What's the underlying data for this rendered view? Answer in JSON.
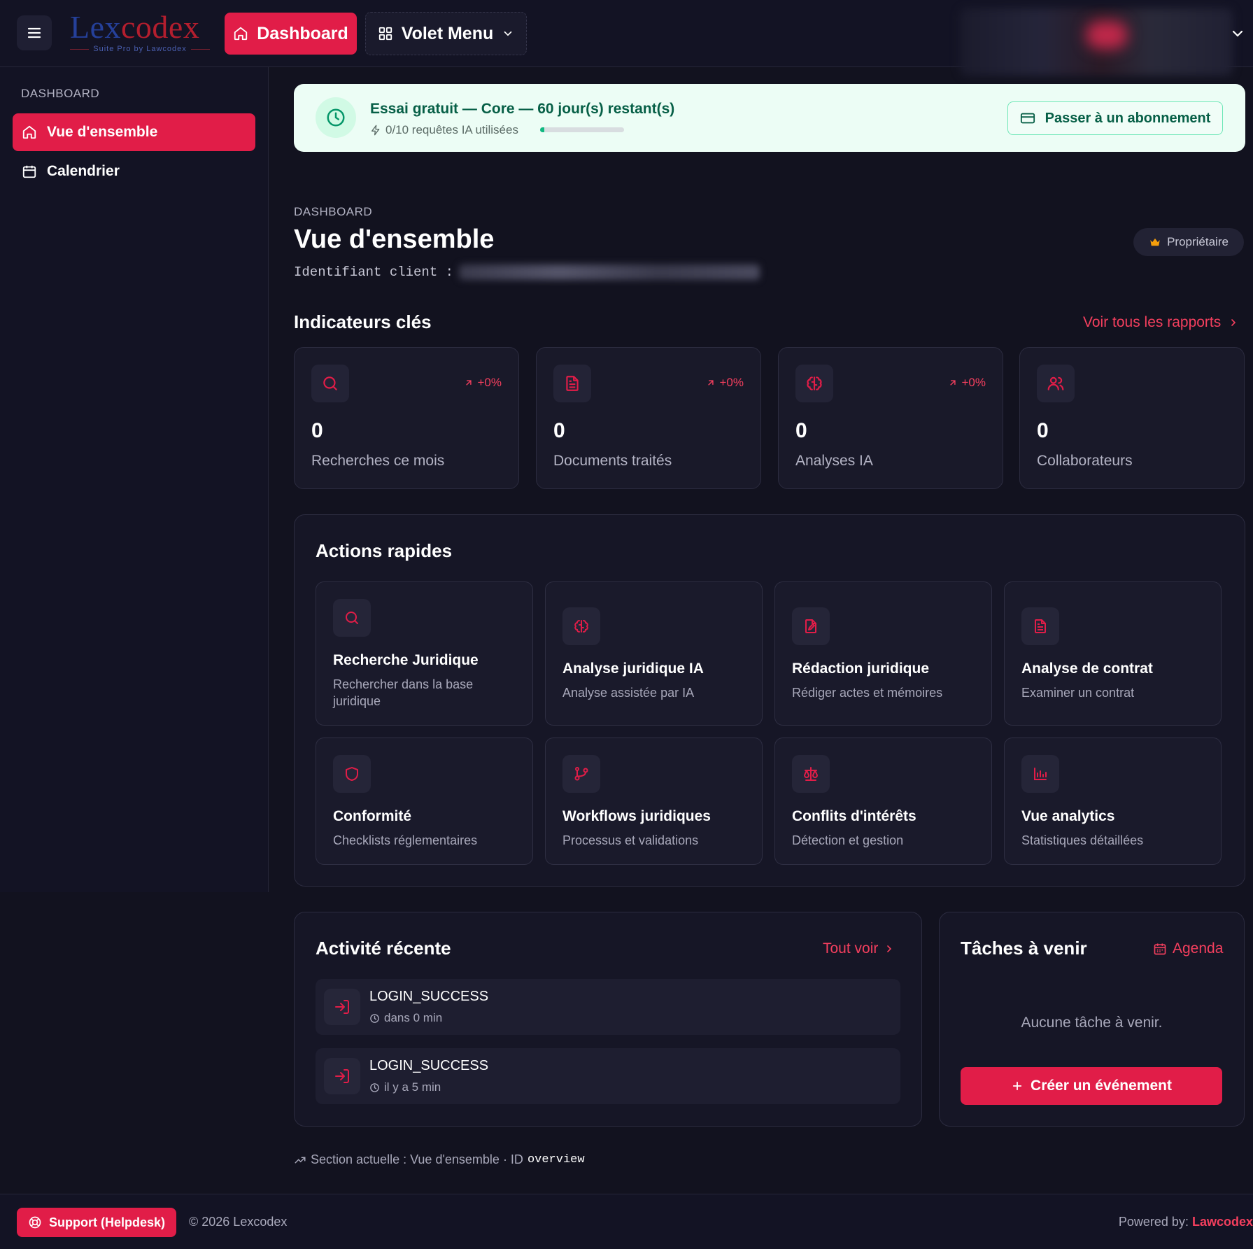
{
  "header": {
    "logo_text_a": "Lex",
    "logo_text_b": "codex",
    "logo_subtitle": "Suite Pro by Lawcodex",
    "dashboard_label": "Dashboard",
    "volet_label": "Volet Menu"
  },
  "sidebar": {
    "heading": "DASHBOARD",
    "items": [
      {
        "label": "Vue d'ensemble",
        "icon": "home-icon",
        "active": true
      },
      {
        "label": "Calendrier",
        "icon": "calendar-icon",
        "active": false
      }
    ]
  },
  "trial": {
    "title": "Essai gratuit — Core — 60 jour(s) restant(s)",
    "usage": "0/10 requêtes IA utilisées",
    "usage_fraction": 0.05,
    "upgrade_label": "Passer à un abonnement"
  },
  "page": {
    "breadcrumb": "DASHBOARD",
    "title": "Vue d'ensemble",
    "client_id_label": "Identifiant client :",
    "owner_badge": "Propriétaire"
  },
  "kpis": {
    "title": "Indicateurs clés",
    "see_all": "Voir tous les rapports",
    "items": [
      {
        "value": "0",
        "label": "Recherches ce mois",
        "trend": "+0%",
        "icon": "search-icon"
      },
      {
        "value": "0",
        "label": "Documents traités",
        "trend": "+0%",
        "icon": "document-icon"
      },
      {
        "value": "0",
        "label": "Analyses IA",
        "trend": "+0%",
        "icon": "brain-icon"
      },
      {
        "value": "0",
        "label": "Collaborateurs",
        "trend": "",
        "icon": "users-icon"
      }
    ]
  },
  "quick_actions": {
    "title": "Actions rapides",
    "items": [
      {
        "title": "Recherche Juridique",
        "desc": "Rechercher dans la base juridique",
        "icon": "search-icon"
      },
      {
        "title": "Analyse juridique IA",
        "desc": "Analyse assistée par IA",
        "icon": "brain-icon"
      },
      {
        "title": "Rédaction juridique",
        "desc": "Rédiger actes et mémoires",
        "icon": "file-pen-icon"
      },
      {
        "title": "Analyse de contrat",
        "desc": "Examiner un contrat",
        "icon": "document-icon"
      },
      {
        "title": "Conformité",
        "desc": "Checklists réglementaires",
        "icon": "shield-icon"
      },
      {
        "title": "Workflows juridiques",
        "desc": "Processus et validations",
        "icon": "git-branch-icon"
      },
      {
        "title": "Conflits d'intérêts",
        "desc": "Détection et gestion",
        "icon": "scale-icon"
      },
      {
        "title": "Vue analytics",
        "desc": "Statistiques détaillées",
        "icon": "bar-chart-icon"
      }
    ]
  },
  "activity": {
    "title": "Activité récente",
    "see_all": "Tout voir",
    "items": [
      {
        "event": "LOGIN_SUCCESS",
        "time": "dans 0 min"
      },
      {
        "event": "LOGIN_SUCCESS",
        "time": "il y a 5 min"
      }
    ]
  },
  "tasks": {
    "title": "Tâches à venir",
    "agenda": "Agenda",
    "empty": "Aucune tâche à venir.",
    "create": "Créer un événement"
  },
  "section_note": {
    "text": "Section actuelle : Vue d'ensemble · ID",
    "id": "overview"
  },
  "footer": {
    "support": "Support (Helpdesk)",
    "copyright": "© 2026 Lexcodex",
    "powered_label": "Powered by:",
    "powered_brand": "Lawcodex"
  },
  "colors": {
    "accent": "#e11d48",
    "background": "#12121f",
    "trial_bg": "#ecfdf5"
  }
}
